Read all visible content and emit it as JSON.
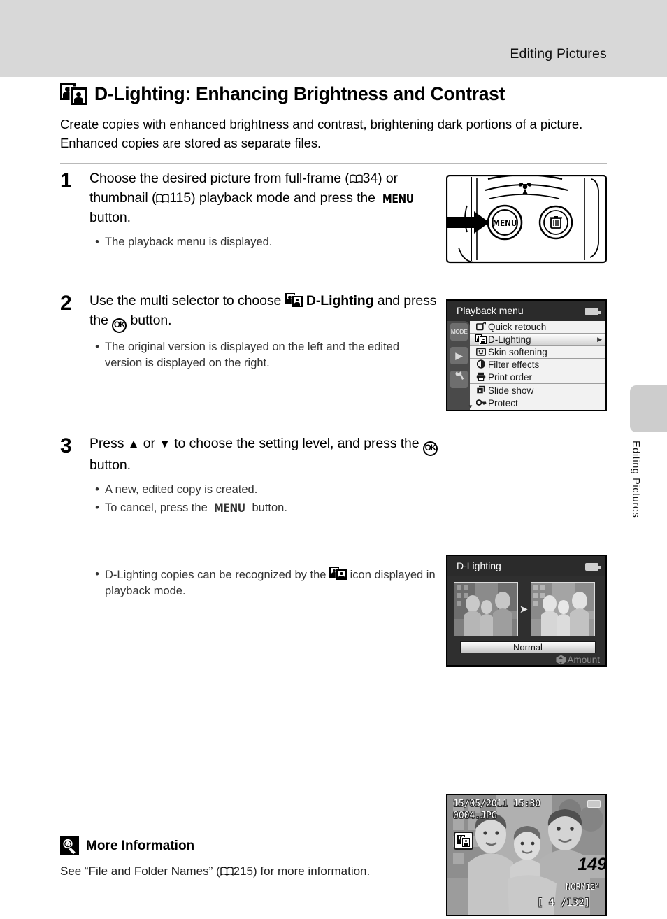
{
  "header": {
    "title": "Editing Pictures"
  },
  "side_tab": {
    "label": "Editing Pictures"
  },
  "chapter": {
    "icon": "d-lighting-icon",
    "title": "D-Lighting: Enhancing Brightness and Contrast",
    "intro": "Create copies with enhanced brightness and contrast, brightening dark portions of a picture. Enhanced copies are stored as separate files."
  },
  "steps": [
    {
      "number": "1",
      "lead_part1": "Choose the desired picture from full-frame (",
      "ref1": "34",
      "lead_part2": ") or thumbnail (",
      "ref2": "115",
      "lead_part3": ") playback mode and press the ",
      "menu_label": "MENU",
      "lead_part4": " button.",
      "bullets": [
        "The playback menu is displayed."
      ]
    },
    {
      "number": "2",
      "lead_part1": "Use the multi selector to choose ",
      "bold1": "D-Lighting",
      "lead_part2": " and press the ",
      "ok_label": "OK",
      "lead_part3": " button.",
      "bullets": [
        "The original version is displayed on the left and the edited version is displayed on the right."
      ]
    },
    {
      "number": "3",
      "lead_part1": "Press ",
      "up_arrow": "▲",
      "lead_part2": " or ",
      "down_arrow": "▼",
      "lead_part3": " to choose the setting level, and press the ",
      "ok_label": "OK",
      "lead_part4": " button.",
      "bullets": [
        "A new, edited copy is created.",
        "To cancel, press the "
      ],
      "bullet2_suffix": " button.",
      "menu_label": "MENU"
    }
  ],
  "extra_note": {
    "part1": "D-Lighting copies can be recognized by the ",
    "part2": " icon displayed in playback mode."
  },
  "figures": {
    "camera": {
      "menu_button_label": "MENU",
      "delete_button_label": "trash-icon",
      "macro_label": "macro-flower-icon",
      "arrow": "pointer-arrow"
    },
    "playback_menu": {
      "title": "Playback menu",
      "battery_icon": "battery-icon",
      "side_icons": [
        "MODE",
        "▶",
        "wrench-icon"
      ],
      "items": [
        {
          "icon": "quick-retouch-icon",
          "label": "Quick retouch",
          "selected": false,
          "arrow": ""
        },
        {
          "icon": "d-lighting-icon",
          "label": "D-Lighting",
          "selected": true,
          "arrow": "▶"
        },
        {
          "icon": "skin-softening-icon",
          "label": "Skin softening",
          "selected": false,
          "arrow": ""
        },
        {
          "icon": "filter-effects-icon",
          "label": "Filter effects",
          "selected": false,
          "arrow": ""
        },
        {
          "icon": "print-order-icon",
          "label": "Print order",
          "selected": false,
          "arrow": ""
        },
        {
          "icon": "slide-show-icon",
          "label": "Slide show",
          "selected": false,
          "arrow": ""
        },
        {
          "icon": "protect-key-icon",
          "label": "Protect",
          "selected": false,
          "arrow": ""
        }
      ]
    },
    "d_lighting_screen": {
      "title": "D-Lighting",
      "battery_icon": "battery-icon",
      "level_label": "Normal",
      "amount_label": "Amount",
      "left_thumb": "original-preview",
      "right_thumb": "edited-preview"
    },
    "playback_screen": {
      "date": "15/05/2011  15:30",
      "filename": "0004.JPG",
      "battery_icon": "battery-icon",
      "quality": "NORM",
      "size": "12",
      "size_unit": "M",
      "frame_counter": "[  4 /132]",
      "dlighting_badge": "d-lighting-icon"
    }
  },
  "more_information": {
    "icon": "lightbulb-icon",
    "title": "More Information",
    "text_part1": "See “File and Folder Names” (",
    "ref": "215",
    "text_part2": ") for more information."
  },
  "page_number": "149",
  "colors": {
    "header_band": "#d8d8d8",
    "side_tab": "#cdcdcd",
    "rule": "#b9b9b9",
    "lcd_bg": "#2b2b2b",
    "menu_list_bg": "#f2f2f2"
  }
}
